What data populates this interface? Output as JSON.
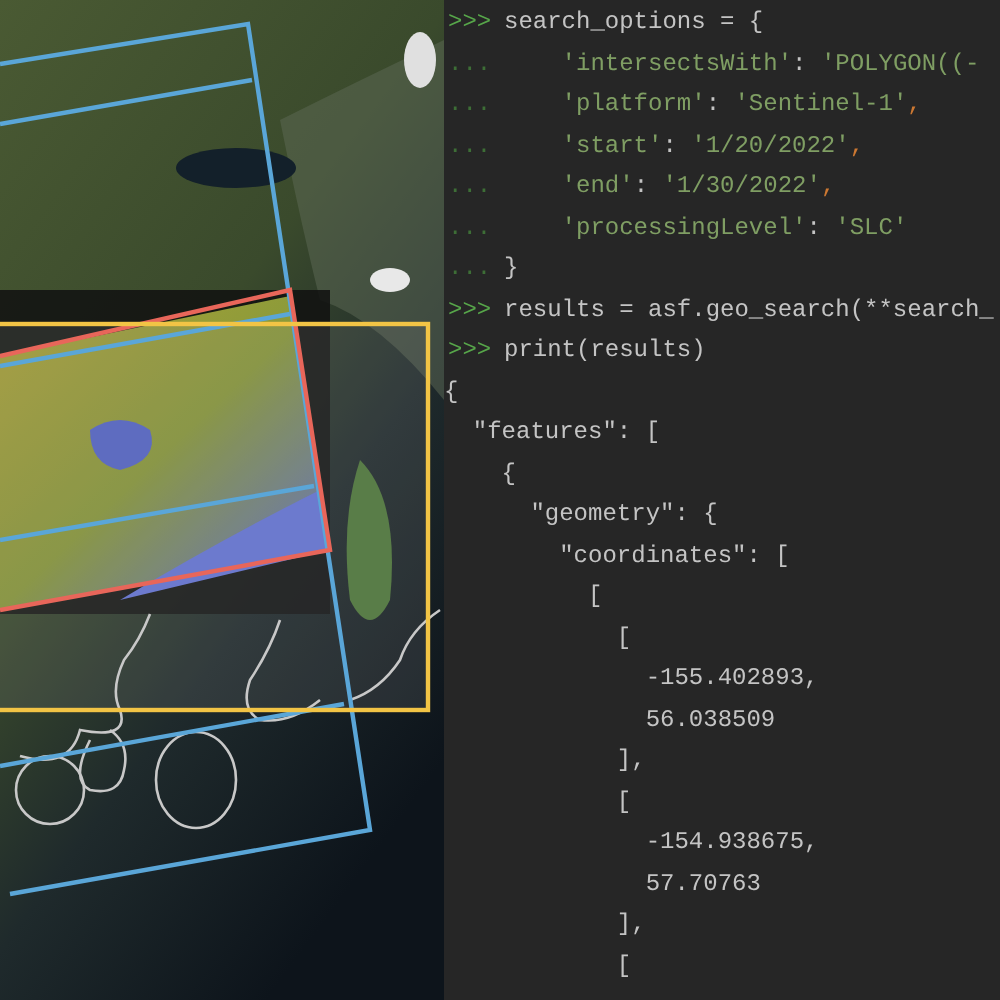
{
  "console": {
    "lines": [
      {
        "kind": "prompt",
        "prompt": ">>>",
        "tokens": [
          {
            "kind": "code",
            "text": "search_options = {"
          }
        ]
      },
      {
        "kind": "continuation",
        "prompt": "...",
        "tokens": [
          {
            "kind": "string",
            "text": "    'intersectsWith'"
          },
          {
            "kind": "code",
            "text": ": "
          },
          {
            "kind": "string",
            "text": "'POLYGON((-"
          }
        ]
      },
      {
        "kind": "continuation",
        "prompt": "...",
        "tokens": [
          {
            "kind": "string",
            "text": "    'platform'"
          },
          {
            "kind": "code",
            "text": ": "
          },
          {
            "kind": "string",
            "text": "'Sentinel-1'"
          },
          {
            "kind": "punct",
            "text": ","
          }
        ]
      },
      {
        "kind": "continuation",
        "prompt": "...",
        "tokens": [
          {
            "kind": "string",
            "text": "    'start'"
          },
          {
            "kind": "code",
            "text": ": "
          },
          {
            "kind": "string",
            "text": "'1/20/2022'"
          },
          {
            "kind": "punct",
            "text": ","
          }
        ]
      },
      {
        "kind": "continuation",
        "prompt": "...",
        "tokens": [
          {
            "kind": "string",
            "text": "    'end'"
          },
          {
            "kind": "code",
            "text": ": "
          },
          {
            "kind": "string",
            "text": "'1/30/2022'"
          },
          {
            "kind": "punct",
            "text": ","
          }
        ]
      },
      {
        "kind": "continuation",
        "prompt": "...",
        "tokens": [
          {
            "kind": "string",
            "text": "    'processingLevel'"
          },
          {
            "kind": "code",
            "text": ": "
          },
          {
            "kind": "string",
            "text": "'SLC'"
          }
        ]
      },
      {
        "kind": "continuation",
        "prompt": "...",
        "tokens": [
          {
            "kind": "code",
            "text": "}"
          }
        ]
      },
      {
        "kind": "prompt",
        "prompt": ">>>",
        "tokens": [
          {
            "kind": "code",
            "text": "results = asf.geo_search(**search_"
          }
        ]
      },
      {
        "kind": "prompt",
        "prompt": ">>>",
        "tokens": [
          {
            "kind": "code",
            "text": "print(results)"
          }
        ]
      },
      {
        "kind": "output",
        "tokens": [
          {
            "kind": "code",
            "text": "{"
          }
        ]
      },
      {
        "kind": "output",
        "tokens": [
          {
            "kind": "code",
            "text": "  \"features\": ["
          }
        ]
      },
      {
        "kind": "output",
        "tokens": [
          {
            "kind": "code",
            "text": "    {"
          }
        ]
      },
      {
        "kind": "output",
        "tokens": [
          {
            "kind": "code",
            "text": "      \"geometry\": {"
          }
        ]
      },
      {
        "kind": "output",
        "tokens": [
          {
            "kind": "code",
            "text": "        \"coordinates\": ["
          }
        ]
      },
      {
        "kind": "output",
        "tokens": [
          {
            "kind": "code",
            "text": "          ["
          }
        ]
      },
      {
        "kind": "output",
        "tokens": [
          {
            "kind": "code",
            "text": "            ["
          }
        ]
      },
      {
        "kind": "output",
        "tokens": [
          {
            "kind": "code",
            "text": "              -155.402893,"
          }
        ]
      },
      {
        "kind": "output",
        "tokens": [
          {
            "kind": "code",
            "text": "              56.038509"
          }
        ]
      },
      {
        "kind": "output",
        "tokens": [
          {
            "kind": "code",
            "text": "            ],"
          }
        ]
      },
      {
        "kind": "output",
        "tokens": [
          {
            "kind": "code",
            "text": "            ["
          }
        ]
      },
      {
        "kind": "output",
        "tokens": [
          {
            "kind": "code",
            "text": "              -154.938675,"
          }
        ]
      },
      {
        "kind": "output",
        "tokens": [
          {
            "kind": "code",
            "text": "              57.70763"
          }
        ]
      },
      {
        "kind": "output",
        "tokens": [
          {
            "kind": "code",
            "text": "            ],"
          }
        ]
      },
      {
        "kind": "output",
        "tokens": [
          {
            "kind": "code",
            "text": "            ["
          }
        ]
      }
    ]
  }
}
